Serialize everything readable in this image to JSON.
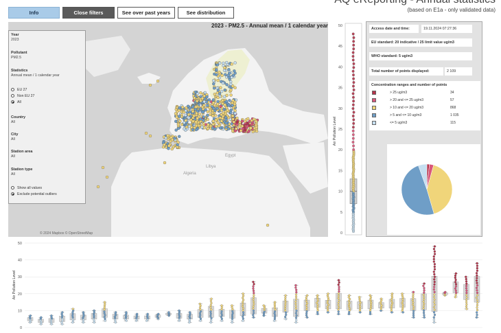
{
  "header": {
    "title": "AQ eReporting - Annual statistics",
    "subtitle": "(based on E1a - only validated data)"
  },
  "toolbar": {
    "info": "Info",
    "close_filters": "Close filters",
    "past_years": "See over past years",
    "distribution": "See distribution"
  },
  "map": {
    "title": "2023 - PM2.5 - Annual mean / 1 calendar year",
    "attribution": "© 2024 Mapbox © OpenStreetMap",
    "place_labels": [
      "Algeria",
      "Libya",
      "Egypt"
    ]
  },
  "filters": {
    "year_label": "Year",
    "year_value": "2023",
    "pollutant_label": "Pollutant",
    "pollutant_value": "PM2.5",
    "statistics_label": "Statistics",
    "statistics_value": "Annual mean / 1 calendar year",
    "scope_options": [
      "EU 27",
      "Non EU 27",
      "All"
    ],
    "scope_selected": "All",
    "country_label": "Country",
    "country_value": "All",
    "city_label": "City",
    "city_value": "All",
    "station_area_label": "Station area",
    "station_area_value": "All",
    "station_type_label": "Station type",
    "station_type_value": "All",
    "outlier_options": [
      "Show all values",
      "Exclude potential outliers"
    ],
    "outlier_selected": "Exclude potential outliers"
  },
  "vertical_box": {
    "ylabel": "Air Pollution Level",
    "ticks": [
      0,
      5,
      10,
      15,
      20,
      25,
      30,
      35,
      40,
      45,
      50
    ],
    "ylim": [
      0,
      50
    ]
  },
  "info_panel": {
    "access_label": "Access date and time:",
    "access_value": "19.11.2024 07:27:36",
    "eu_standard": "EU standard: 20 indicative / 25 limit value ug/m3",
    "who_standard": "WHO standard: 5 ug/m3",
    "total_label": "Total number of points displayed:",
    "total_value": "2 109",
    "ranges_title": "Concentration ranges and number of points",
    "ranges": [
      {
        "label": "> 25 ug/m3",
        "count": "34",
        "color": "#b5334a"
      },
      {
        "label": "> 20 and <= 25 ug/m3",
        "count": "57",
        "color": "#d9567a"
      },
      {
        "label": "> 10 and <= 20 ug/m3",
        "count": "868",
        "color": "#f0d57a"
      },
      {
        "label": "> 5 and <= 10 ug/m3",
        "count": "1 035",
        "color": "#6f9ec7"
      },
      {
        "label": "<= 5 ug/m3",
        "count": "115",
        "color": "#c6dff0"
      }
    ]
  },
  "bottom_chart": {
    "ylabel": "Air Pollution Level",
    "ticks": [
      0,
      10,
      20,
      30,
      40,
      50
    ]
  },
  "chart_data": {
    "type": "pie",
    "categories": [
      "> 25 ug/m3",
      "> 20 and <= 25 ug/m3",
      "> 10 and <= 20 ug/m3",
      "> 5 and <= 10 ug/m3",
      "<= 5 ug/m3"
    ],
    "values": [
      34,
      57,
      868,
      1035,
      115
    ],
    "colors": [
      "#b5334a",
      "#d9567a",
      "#f0d57a",
      "#6f9ec7",
      "#c6dff0"
    ]
  }
}
